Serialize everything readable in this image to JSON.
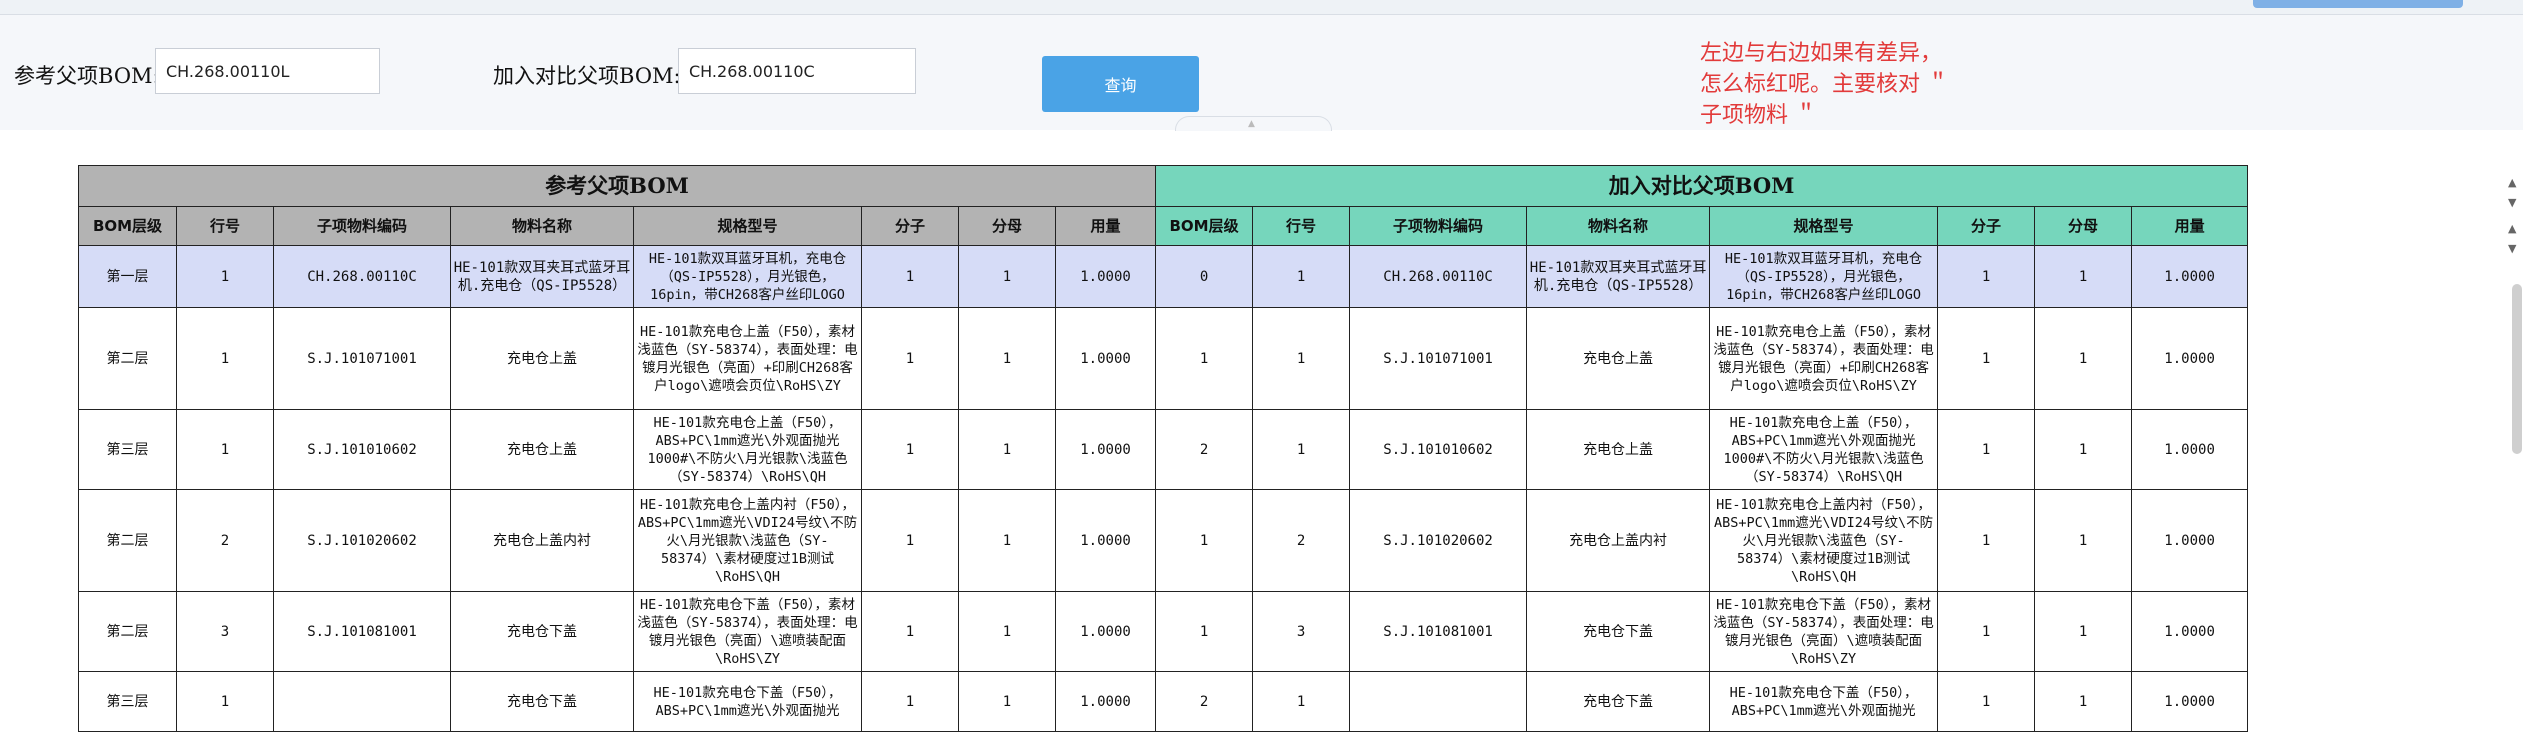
{
  "search": {
    "ref_label": "参考父项BOM:",
    "ref_value": "CH.268.00110L",
    "cmp_label": "加入对比父项BOM:",
    "cmp_value": "CH.268.00110C",
    "query_button": "查询"
  },
  "annotation": "左边与右边如果有差异，怎么标红呢。主要核对 ＂ 子项物料 ＂",
  "table": {
    "left_title": "参考父项BOM",
    "right_title": "加入对比父项BOM",
    "columns": [
      "BOM层级",
      "行号",
      "子项物料编码",
      "物料名称",
      "规格型号",
      "分子",
      "分母",
      "用量"
    ],
    "rows": [
      {
        "left": [
          "第一层",
          "1",
          "CH.268.00110C",
          "HE-101款双耳夹耳式蓝牙耳机.充电仓（QS-IP5528）",
          "HE-101款双耳蓝牙耳机，充电仓（QS-IP5528），月光银色，16pin，带CH268客户丝印LOGO",
          "1",
          "1",
          "1.0000"
        ],
        "right": [
          "0",
          "1",
          "CH.268.00110C",
          "HE-101款双耳夹耳式蓝牙耳机.充电仓（QS-IP5528）",
          "HE-101款双耳蓝牙耳机，充电仓（QS-IP5528），月光银色，16pin，带CH268客户丝印LOGO",
          "1",
          "1",
          "1.0000"
        ]
      },
      {
        "left": [
          "第二层",
          "1",
          "S.J.101071001",
          "充电仓上盖",
          "HE-101款充电仓上盖（F50），素材浅蓝色（SY-58374），表面处理：电镀月光银色（亮面）+印刷CH268客户logo\\遮喷会页位\\RoHS\\ZY",
          "1",
          "1",
          "1.0000"
        ],
        "right": [
          "1",
          "1",
          "S.J.101071001",
          "充电仓上盖",
          "HE-101款充电仓上盖（F50），素材浅蓝色（SY-58374），表面处理：电镀月光银色（亮面）+印刷CH268客户logo\\遮喷会页位\\RoHS\\ZY",
          "1",
          "1",
          "1.0000"
        ]
      },
      {
        "left": [
          "第三层",
          "1",
          "S.J.101010602",
          "充电仓上盖",
          "HE-101款充电仓上盖（F50），ABS+PC\\1mm遮光\\外观面抛光1000#\\不防火\\月光银款\\浅蓝色（SY-58374）\\RoHS\\QH",
          "1",
          "1",
          "1.0000"
        ],
        "right": [
          "2",
          "1",
          "S.J.101010602",
          "充电仓上盖",
          "HE-101款充电仓上盖（F50），ABS+PC\\1mm遮光\\外观面抛光1000#\\不防火\\月光银款\\浅蓝色（SY-58374）\\RoHS\\QH",
          "1",
          "1",
          "1.0000"
        ]
      },
      {
        "left": [
          "第二层",
          "2",
          "S.J.101020602",
          "充电仓上盖内衬",
          "HE-101款充电仓上盖内衬（F50），ABS+PC\\1mm遮光\\VDI24号纹\\不防火\\月光银款\\浅蓝色（SY-58374）\\素材硬度过1B测试\\RoHS\\QH",
          "1",
          "1",
          "1.0000"
        ],
        "right": [
          "1",
          "2",
          "S.J.101020602",
          "充电仓上盖内衬",
          "HE-101款充电仓上盖内衬（F50），ABS+PC\\1mm遮光\\VDI24号纹\\不防火\\月光银款\\浅蓝色（SY-58374）\\素材硬度过1B测试\\RoHS\\QH",
          "1",
          "1",
          "1.0000"
        ]
      },
      {
        "left": [
          "第二层",
          "3",
          "S.J.101081001",
          "充电仓下盖",
          "HE-101款充电仓下盖（F50），素材浅蓝色（SY-58374），表面处理：电镀月光银色（亮面）\\遮喷装配面\\RoHS\\ZY",
          "1",
          "1",
          "1.0000"
        ],
        "right": [
          "1",
          "3",
          "S.J.101081001",
          "充电仓下盖",
          "HE-101款充电仓下盖（F50），素材浅蓝色（SY-58374），表面处理：电镀月光银色（亮面）\\遮喷装配面\\RoHS\\ZY",
          "1",
          "1",
          "1.0000"
        ]
      },
      {
        "left": [
          "第三层",
          "1",
          "",
          "充电仓下盖",
          "HE-101款充电仓下盖（F50），ABS+PC\\1mm遮光\\外观面抛光",
          "1",
          "1",
          "1.0000"
        ],
        "right": [
          "2",
          "1",
          "",
          "充电仓下盖",
          "HE-101款充电仓下盖（F50），ABS+PC\\1mm遮光\\外观面抛光",
          "1",
          "1",
          "1.0000"
        ]
      }
    ]
  }
}
